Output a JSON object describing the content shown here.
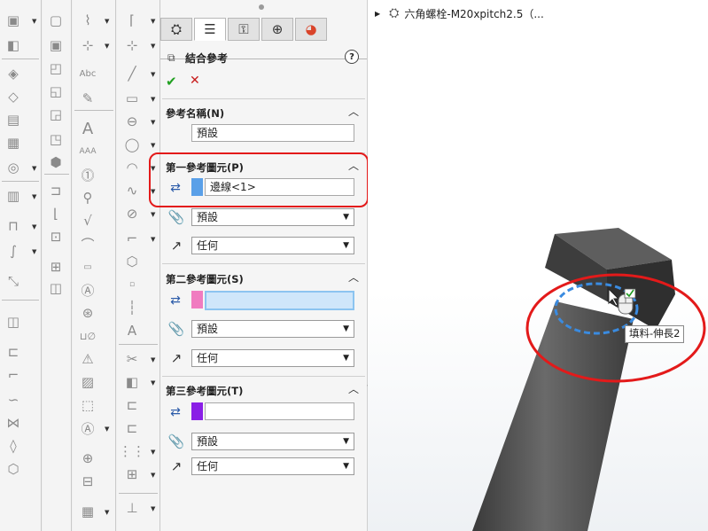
{
  "feature_tree": {
    "part_name": "六角螺栓-M20xpitch2.5（..."
  },
  "property_manager": {
    "title": "結合參考",
    "help": "?",
    "ok": "✔",
    "cancel": "✕",
    "tabs": [
      "feature-manager",
      "property-manager",
      "configuration-manager",
      "dimxpert-manager",
      "display-manager"
    ],
    "reference_name": {
      "header": "參考名稱(N)",
      "value": "預設"
    },
    "first_reference": {
      "header": "第一參考圖元(P)",
      "selection": "邊線<1>",
      "swatch_color": "#5aa0e8",
      "mate_type": "預設",
      "alignment": "任何"
    },
    "second_reference": {
      "header": "第二參考圖元(S)",
      "selection": "",
      "swatch_color": "#f07cc0",
      "mate_type": "預設",
      "alignment": "任何"
    },
    "third_reference": {
      "header": "第三參考圖元(T)",
      "selection": "",
      "swatch_color": "#8a1fe6",
      "mate_type": "預設",
      "alignment": "任何"
    }
  },
  "viewport": {
    "tooltip": "填料-伸長2"
  },
  "colors": {
    "highlight": "#e31a1a",
    "model_body": "#4a4a4a",
    "selection_edge": "#3a8be0"
  }
}
